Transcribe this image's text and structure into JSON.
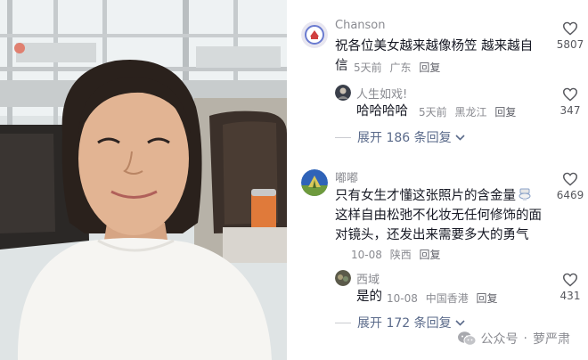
{
  "comments": [
    {
      "username": "Chanson",
      "text": "祝各位美女越来越像杨笠 越来越自信",
      "time": "5天前",
      "location": "广东",
      "reply_label": "回复",
      "likes": "5807"
    },
    {
      "username": "人生如戏!",
      "text": "哈哈哈哈",
      "time": "5天前",
      "location": "黑龙江",
      "reply_label": "回复",
      "likes": "347",
      "is_reply": true
    },
    {
      "username": "嘟嘟",
      "text": "只有女生才懂这张照片的含金量",
      "text_cont": "这样自由松弛不化妆无任何修饰的面对镜头，还发出来需要多大的勇气",
      "time": "10-08",
      "location": "陕西",
      "reply_label": "回复",
      "likes": "6469"
    },
    {
      "username": "西域",
      "text": "是的",
      "time": "10-08",
      "location": "中国香港",
      "reply_label": "回复",
      "likes": "431",
      "is_reply": true
    }
  ],
  "expand_1": "展开 186 条回复",
  "expand_2": "展开 172 条回复",
  "watermark": {
    "account": "公众号",
    "separator": "·",
    "name": "萝严肃"
  },
  "icons": {
    "like": "heart-outline-icon",
    "expand": "chevron-down-icon",
    "watermark": "wechat-icon",
    "emoji": "toilet-emoji-icon"
  },
  "colors": {
    "link": "#5a6a8a",
    "muted": "#8a8b91",
    "text": "#161823"
  }
}
